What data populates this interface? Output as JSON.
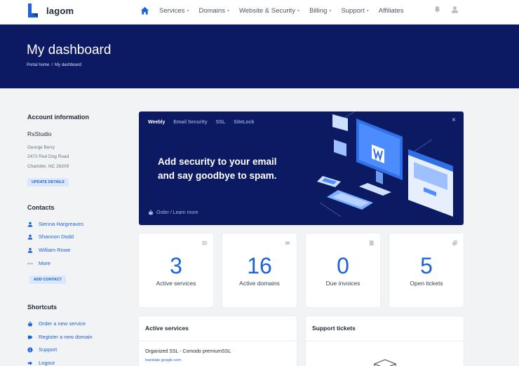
{
  "brand": {
    "name": "lagom",
    "color": "#1e63d6"
  },
  "nav": {
    "items": [
      {
        "label": "Services",
        "dropdown": true
      },
      {
        "label": "Domains",
        "dropdown": true
      },
      {
        "label": "Website & Security",
        "dropdown": true
      },
      {
        "label": "Billing",
        "dropdown": true
      },
      {
        "label": "Support",
        "dropdown": true
      },
      {
        "label": "Affiliates",
        "dropdown": false
      }
    ]
  },
  "hero": {
    "title": "My dashboard",
    "breadcrumb": [
      "Portal home",
      "/",
      "My dashboard"
    ],
    "bg": "#0c1a63"
  },
  "sidebar": {
    "account": {
      "heading": "Account information",
      "company": "RsStudio",
      "name": "George Berry",
      "address1": "2472 Red Dog Road",
      "address2": "Charlotte, NC 28209",
      "button": "UPDATE DETAILS"
    },
    "contacts": {
      "heading": "Contacts",
      "items": [
        "Sienna Hargreaves",
        "Shannon Dodd",
        "William Rowe"
      ],
      "more": "More",
      "button": "ADD CONTACT"
    },
    "shortcuts": {
      "heading": "Shortcuts",
      "items": [
        "Order a new service",
        "Register a new domain",
        "Support",
        "Logout"
      ]
    }
  },
  "promo": {
    "tabs": [
      "Weebly",
      "Email Security",
      "SSL",
      "SiteLock"
    ],
    "heading_line1": "Add security to your email",
    "heading_line2": "and say goodbye to spam.",
    "link": "Order / Learn more",
    "close": "×"
  },
  "stats": [
    {
      "value": "3",
      "label": "Active services",
      "icon": "server-icon"
    },
    {
      "value": "16",
      "label": "Active domains",
      "icon": "tag-icon"
    },
    {
      "value": "0",
      "label": "Due invoices",
      "icon": "invoice-icon"
    },
    {
      "value": "5",
      "label": "Open tickets",
      "icon": "ticket-icon"
    }
  ],
  "panels": {
    "services": {
      "title": "Active services",
      "item": "Organized SSL - Comodo premiumSSL",
      "item_sub": "translate.google.com"
    },
    "tickets": {
      "title": "Support tickets"
    }
  }
}
